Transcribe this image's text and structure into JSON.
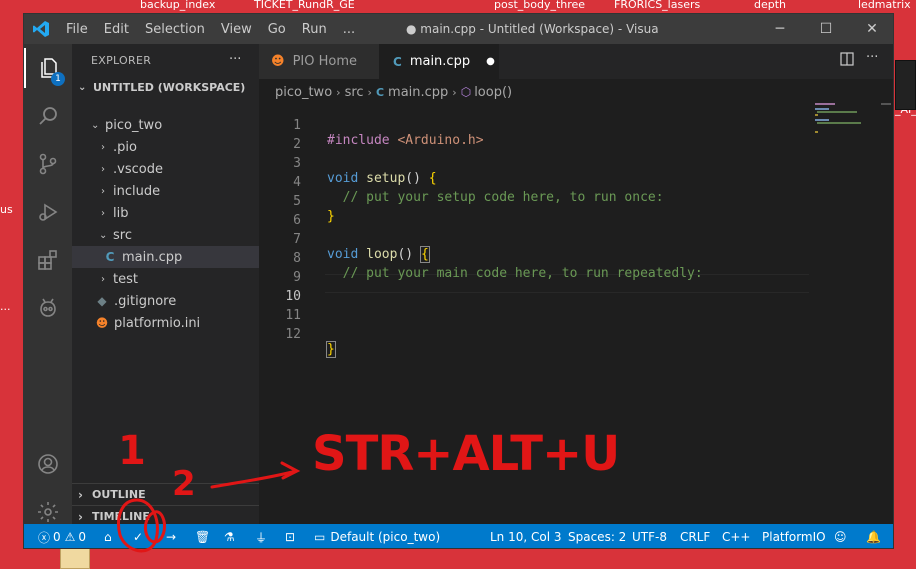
{
  "desktop": {
    "top_labels": [
      "backup_index",
      "TICKET_RundR_GE",
      "post_body_three",
      "FRORICS_lasers",
      "depth",
      "ledmatrix"
    ],
    "left_labels": [
      "us",
      "..."
    ],
    "right_label": "_AI_"
  },
  "titlebar": {
    "menu": [
      "File",
      "Edit",
      "Selection",
      "View",
      "Go",
      "Run",
      "..."
    ],
    "title": "● main.cpp - Untitled (Workspace) - Visual Stu...",
    "minimize": "─",
    "maximize": "☐",
    "close": "✕"
  },
  "activity": {
    "explorer_badge": "1"
  },
  "sidebar": {
    "header": "EXPLORER",
    "more": "···",
    "workspace": "UNTITLED (WORKSPACE)",
    "tree": [
      {
        "label": "pico_two",
        "kind": "folder-open"
      },
      {
        "label": ".pio",
        "kind": "folder"
      },
      {
        "label": ".vscode",
        "kind": "folder"
      },
      {
        "label": "include",
        "kind": "folder"
      },
      {
        "label": "lib",
        "kind": "folder"
      },
      {
        "label": "src",
        "kind": "folder-open"
      },
      {
        "label": "main.cpp",
        "kind": "cpp-file"
      },
      {
        "label": "test",
        "kind": "folder"
      },
      {
        "label": ".gitignore",
        "kind": "git-file"
      },
      {
        "label": "platformio.ini",
        "kind": "pio-file"
      }
    ],
    "outline": "OUTLINE",
    "timeline": "TIMELINE"
  },
  "tabs": [
    {
      "label": "PIO Home",
      "active": false
    },
    {
      "label": "main.cpp",
      "active": true,
      "modified_dot": "●"
    }
  ],
  "breadcrumb": [
    "pico_two",
    "src",
    "main.cpp",
    "loop()"
  ],
  "code": {
    "line_numbers": [
      "1",
      "2",
      "3",
      "4",
      "5",
      "6",
      "7",
      "8",
      "9",
      "10",
      "11",
      "12"
    ],
    "current_line": "10",
    "l1_directive": "#include",
    "l1_header": "<Arduino.h>",
    "l3_type": "void",
    "l3_name": "setup",
    "l3_parens": "()",
    "l3_brace": "{",
    "l4_comment": "// put your setup code here, to run once:",
    "l5_brace": "}",
    "l7_type": "void",
    "l7_name": "loop",
    "l7_parens": "()",
    "l7_brace": "{",
    "l8_comment": "// put your main code here, to run repeatedly:",
    "l12_brace": "}"
  },
  "statusbar": {
    "errors": "0",
    "warnings": "0",
    "env": "Default (pico_two)",
    "position": "Ln 10, Col 3",
    "spaces": "Spaces: 2",
    "encoding": "UTF-8",
    "eol": "CRLF",
    "language": "C++",
    "platformio": "PlatformIO"
  },
  "annotations": {
    "num1": "1",
    "num2": "2",
    "shortcut": "STR+ALT+U"
  },
  "colors": {
    "activity_bar": "#333333",
    "sidebar": "#252526",
    "editor": "#1e1e1e",
    "statusbar": "#007acc",
    "annotation_red": "#e11616"
  }
}
